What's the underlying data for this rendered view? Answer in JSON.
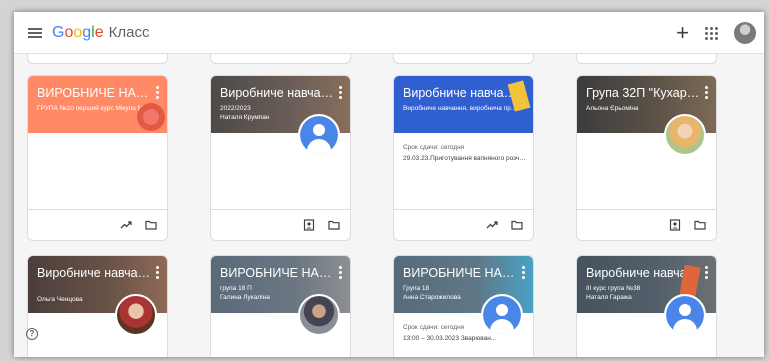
{
  "app": {
    "logo_google": "Google",
    "product_name": "Класс"
  },
  "topbar": {
    "add_symbol": "+"
  },
  "colors": {
    "orange": "#ff8a65",
    "grey_brown": "#4e4a47",
    "blue": "#2f5fd0",
    "dark": "#3c3c3c",
    "slate": "#5a6a7a",
    "teal": "#566a7a"
  },
  "cards": [
    {
      "title": "ВИРОБНИЧЕ НАВЧА...",
      "sub1": "ГРУПА №20 перший курс Мікула М...",
      "sub2": "",
      "due_label": "",
      "due_text": "",
      "avatar": "none",
      "foot": [
        "trend-icon",
        "folder-icon"
      ]
    },
    {
      "title": "Виробниче навчанн...",
      "sub1": "2022/2023",
      "sub2": "Наталя Крумпан",
      "due_label": "",
      "due_text": "",
      "avatar": "default",
      "foot": [
        "gradebook-icon",
        "folder-icon"
      ]
    },
    {
      "title": "Виробниче навчанн...",
      "sub1": "Виробниче навчання, виробнича пр...",
      "sub2": "",
      "due_label": "Срок сдачи: сегодня",
      "due_text": "29.03.23.Приготування вапняного розчин...",
      "avatar": "none",
      "foot": [
        "trend-icon",
        "folder-icon"
      ]
    },
    {
      "title": "Група 32П \"Кухар, ко...",
      "sub1": "Альона Єрьоміна",
      "sub2": "",
      "due_label": "",
      "due_text": "",
      "avatar": "photo3",
      "foot": [
        "gradebook-icon",
        "folder-icon"
      ]
    },
    {
      "title": "Виробниче навчанн...",
      "sub1": "Ольга Ченцова",
      "sub2": "",
      "due_label": "",
      "due_text": "",
      "avatar": "photo1",
      "foot": []
    },
    {
      "title": "ВИРОБНИЧЕ НАВЧА...",
      "sub1": "група 18 П",
      "sub2": "Галина Лукаліна",
      "due_label": "",
      "due_text": "",
      "avatar": "photo2",
      "foot": []
    },
    {
      "title": "ВИРОБНИЧЕ НАВЧА...",
      "sub1": "Група 18",
      "sub2": "Анна Старожилова",
      "due_label": "Срок сдачи: сегодня",
      "due_text": "13:00 – 30.03.2023 Зварюван...",
      "avatar": "default",
      "foot": []
    },
    {
      "title": "Виробниче навчанн...",
      "sub1": "ІІІ курс група №38",
      "sub2": "Наталя Гаража",
      "due_label": "",
      "due_text": "",
      "avatar": "default",
      "foot": []
    }
  ],
  "help_symbol": "?"
}
